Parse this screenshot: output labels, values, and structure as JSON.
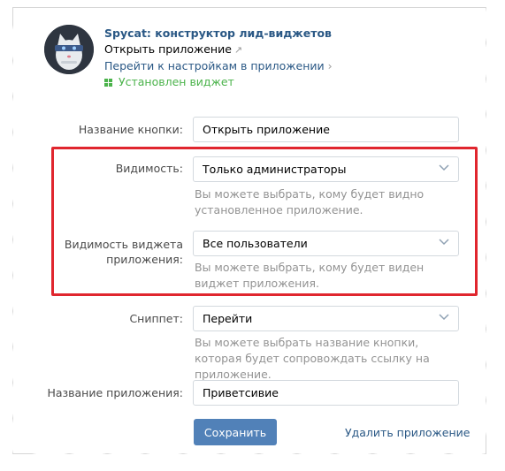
{
  "app": {
    "title": "Spycat: конструктор лид-виджетов",
    "open_link": "Открыть приложение",
    "settings_link": "Перейти к настройкам в приложении",
    "installed_status": "Установлен виджет"
  },
  "form": {
    "button_name": {
      "label": "Название кнопки:",
      "value": "Открыть приложение"
    },
    "visibility": {
      "label": "Видимость:",
      "value": "Только администраторы",
      "hint": "Вы можете выбрать, кому будет видно установленное приложение."
    },
    "widget_visibility": {
      "label": "Видимость виджета приложения:",
      "value": "Все пользователи",
      "hint": "Вы можете выбрать, кому будет виден виджет приложения."
    },
    "snippet": {
      "label": "Сниппет:",
      "value": "Перейти",
      "hint": "Вы можете выбрать название кнопки, которая будет сопровождать ссылку на приложение."
    },
    "app_name": {
      "label": "Название приложения:",
      "value": "Приветсивие"
    }
  },
  "actions": {
    "save_label": "Сохранить",
    "delete_label": "Удалить приложение"
  },
  "colors": {
    "link": "#2a5885",
    "success": "#4bb34b",
    "button": "#5181b8",
    "highlight": "#e0262e",
    "hint": "#939393"
  },
  "icons": {
    "external": "external-link-icon",
    "chevron_right": "chevron-right-icon",
    "widget": "widget-grid-icon",
    "select": "chevron-down-icon"
  }
}
